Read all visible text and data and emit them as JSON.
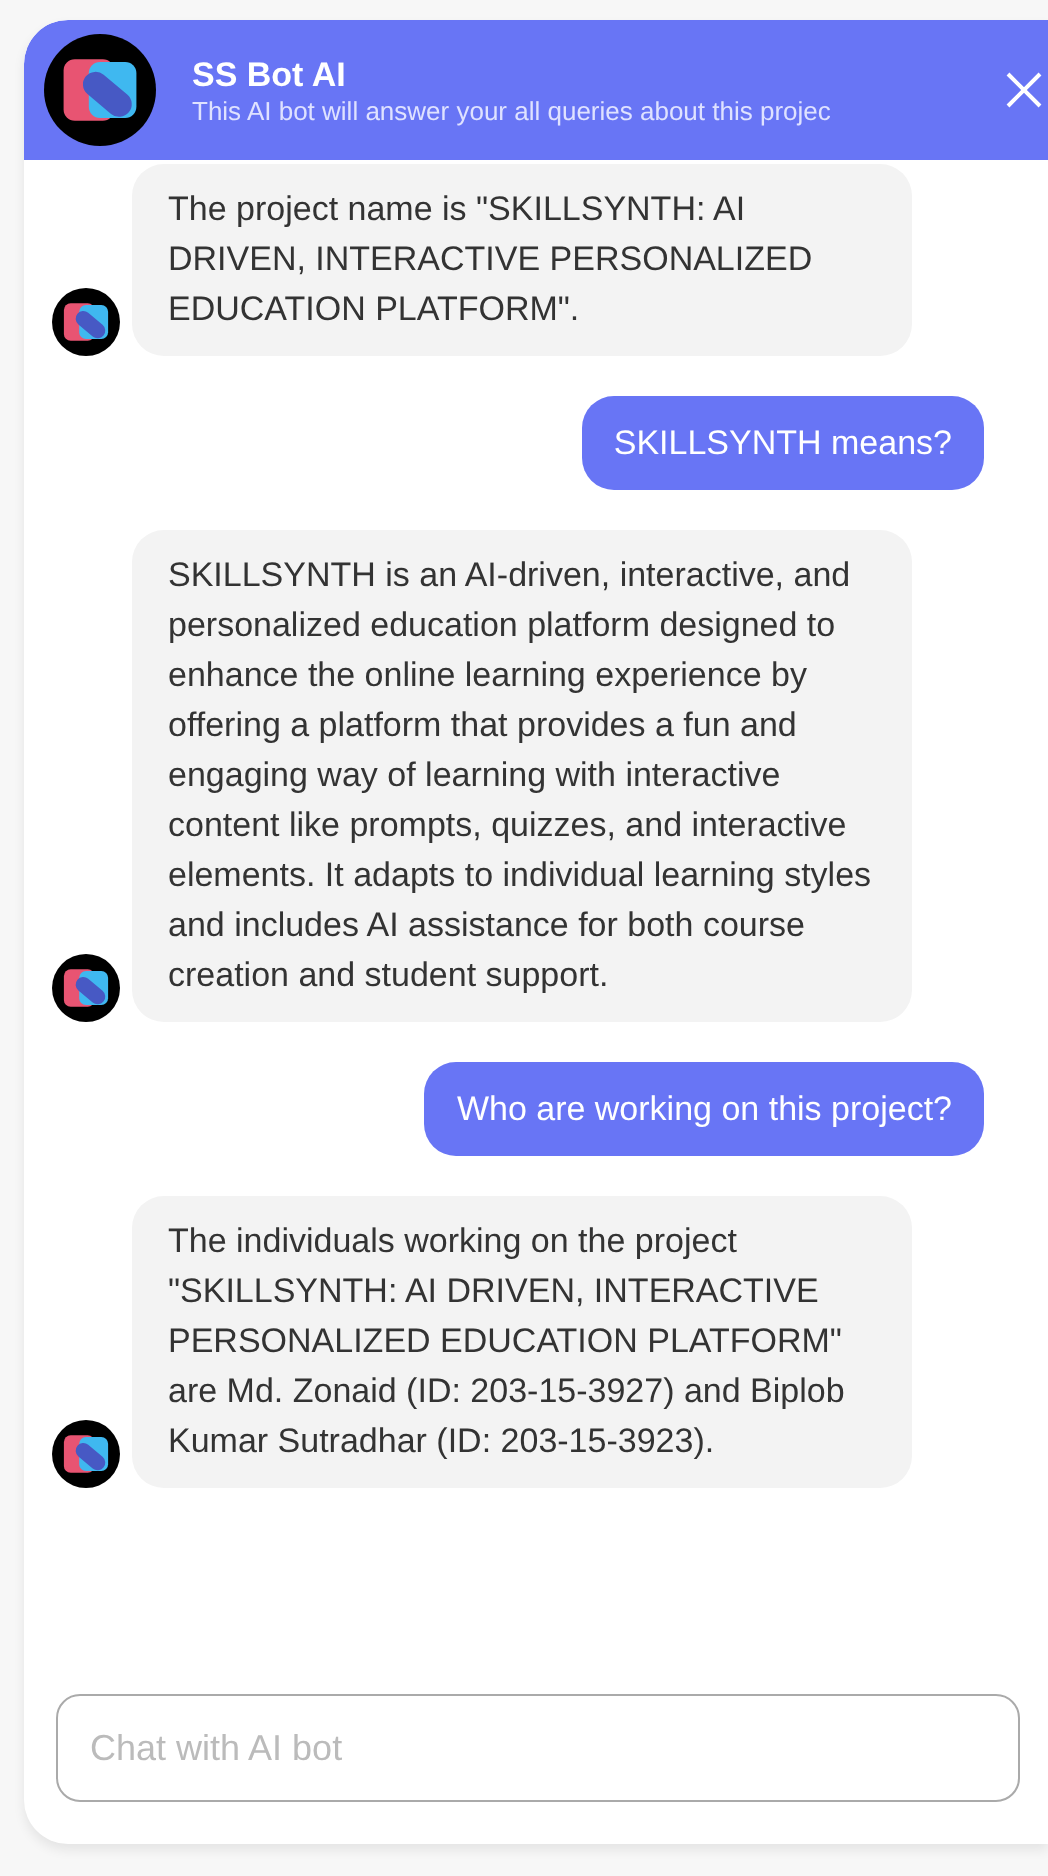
{
  "header": {
    "title": "SS Bot AI",
    "subtitle": "This AI bot will answer your all queries about this projec"
  },
  "messages": [
    {
      "kind": "bot",
      "text": "The project name is \"SKILLSYNTH: AI DRIVEN, INTERACTIVE PERSONALIZED EDUCATION PLATFORM\"."
    },
    {
      "kind": "user",
      "text": "SKILLSYNTH means?"
    },
    {
      "kind": "bot",
      "text": "SKILLSYNTH is an AI-driven, interactive, and personalized education platform designed to enhance the online learning experience by offering a platform that provides a fun and engaging way of learning with interactive content like prompts, quizzes, and interactive elements. It adapts to individual learning styles and includes AI assistance for both course creation and student support."
    },
    {
      "kind": "user",
      "text": "Who are working on this project?"
    },
    {
      "kind": "bot",
      "text": "The individuals working on the project \"SKILLSYNTH: AI DRIVEN, INTERACTIVE PERSONALIZED EDUCATION PLATFORM\" are Md. Zonaid (ID: 203-15-3927) and Biplob Kumar Sutradhar (ID: 203-15-3923)."
    }
  ],
  "input": {
    "placeholder": "Chat with AI bot"
  }
}
